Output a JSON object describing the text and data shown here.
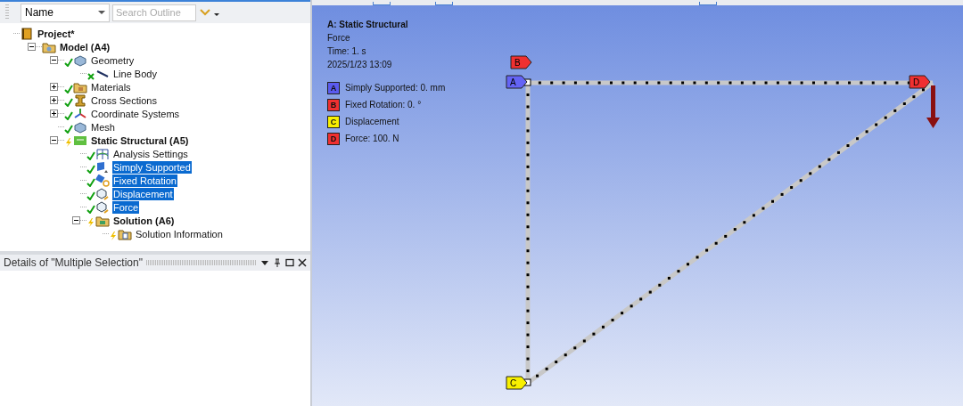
{
  "outline_toolbar": {
    "filter": "Name",
    "search_placeholder": "Search Outline"
  },
  "tree": [
    {
      "label": "Project*",
      "kind": "project",
      "bold": true,
      "selected": false,
      "children": [
        {
          "label": "Model (A4)",
          "kind": "model",
          "bold": true,
          "selected": false,
          "expanded": true,
          "children": [
            {
              "label": "Geometry",
              "kind": "geometry",
              "bold": false,
              "done": true,
              "selected": false,
              "expanded": true,
              "children": [
                {
                  "label": "Line Body",
                  "kind": "line",
                  "bold": false,
                  "done": false,
                  "excluded": true,
                  "selected": false
                }
              ]
            },
            {
              "label": "Materials",
              "kind": "materials",
              "bold": false,
              "done": true,
              "selected": false,
              "expanded": false
            },
            {
              "label": "Cross Sections",
              "kind": "sections",
              "bold": false,
              "done": true,
              "selected": false,
              "expanded": false
            },
            {
              "label": "Coordinate Systems",
              "kind": "coords",
              "bold": false,
              "done": true,
              "selected": false,
              "expanded": false
            },
            {
              "label": "Mesh",
              "kind": "mesh",
              "bold": false,
              "done": true,
              "selected": false
            },
            {
              "label": "Static Structural (A5)",
              "kind": "analysis",
              "bold": true,
              "done": false,
              "selected": false,
              "expanded": true,
              "children": [
                {
                  "label": "Analysis Settings",
                  "kind": "settings",
                  "bold": false,
                  "done": true,
                  "selected": false
                },
                {
                  "label": "Simply Supported",
                  "kind": "support",
                  "bold": false,
                  "done": true,
                  "selected": true
                },
                {
                  "label": "Fixed Rotation",
                  "kind": "rotation",
                  "bold": false,
                  "done": true,
                  "selected": true
                },
                {
                  "label": "Displacement",
                  "kind": "load",
                  "bold": false,
                  "done": true,
                  "selected": true
                },
                {
                  "label": "Force",
                  "kind": "load",
                  "bold": false,
                  "done": true,
                  "selected": true
                },
                {
                  "label": "Solution (A6)",
                  "kind": "solution",
                  "bold": true,
                  "done": false,
                  "selected": false,
                  "expanded": true,
                  "children": [
                    {
                      "label": "Solution Information",
                      "kind": "info",
                      "bold": false,
                      "done": false,
                      "selected": false
                    }
                  ]
                }
              ]
            }
          ]
        }
      ]
    }
  ],
  "details_panel": {
    "title": "Details of \"Multiple Selection\""
  },
  "viewport": {
    "title": "A: Static Structural",
    "subtitle": "Force",
    "time": "Time: 1. s",
    "date": "2025/1/23 13:09",
    "legend": [
      {
        "letter": "A",
        "label": "Simply Supported: 0. mm",
        "color": "#5b5bf0"
      },
      {
        "letter": "B",
        "label": "Fixed Rotation: 0. °",
        "color": "#f03030"
      },
      {
        "letter": "C",
        "label": "Displacement",
        "color": "#f8f000"
      },
      {
        "letter": "D",
        "label": "Force: 100. N",
        "color": "#f03030"
      }
    ],
    "tags": [
      {
        "letter": "B",
        "color": "#f03030"
      },
      {
        "letter": "A",
        "color": "#6464f5"
      },
      {
        "letter": "D",
        "color": "#f03030"
      },
      {
        "letter": "C",
        "color": "#f8f000"
      }
    ]
  }
}
